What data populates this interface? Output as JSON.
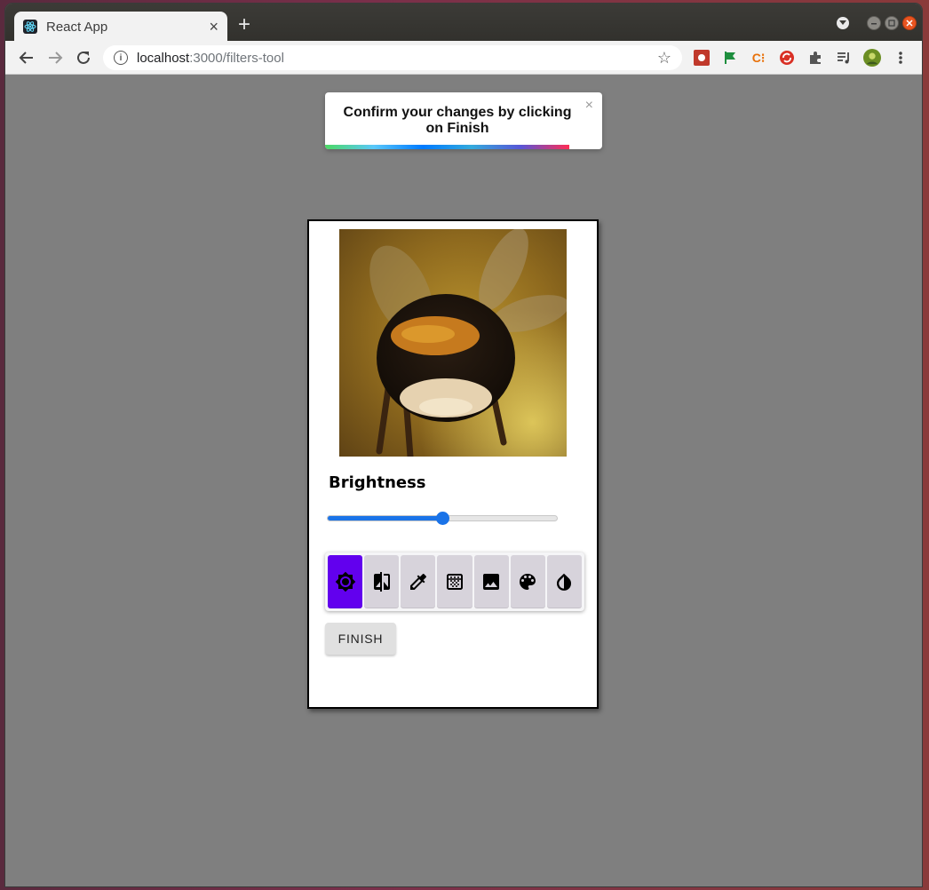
{
  "browser": {
    "tab_title": "React App",
    "url_host": "localhost",
    "url_rest": ":3000/filters-tool",
    "new_tab_symbol": "+",
    "tab_close_symbol": "×"
  },
  "toast": {
    "message": "Confirm your changes by clicking on Finish",
    "close_symbol": "×",
    "progress_fraction": 0.88
  },
  "editor": {
    "slider": {
      "label": "Brightness",
      "value_fraction": 0.5
    },
    "filters": [
      {
        "name": "brightness-icon",
        "active": true
      },
      {
        "name": "contrast-icon",
        "active": false
      },
      {
        "name": "eyedropper-icon",
        "active": false
      },
      {
        "name": "texture-icon",
        "active": false
      },
      {
        "name": "image-icon",
        "active": false
      },
      {
        "name": "palette-icon",
        "active": false
      },
      {
        "name": "invert-icon",
        "active": false
      }
    ],
    "finish_label": "FINISH"
  },
  "colors": {
    "accent": "#6200ee",
    "slider": "#1a73e8",
    "backdrop": "#7f7f7f"
  }
}
